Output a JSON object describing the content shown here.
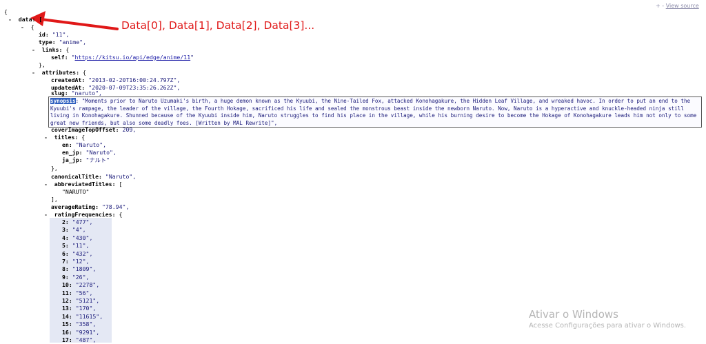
{
  "view_source": {
    "prefix": "+ - ",
    "link": "View source"
  },
  "annotation": {
    "text": "Data[0], Data[1], Data[2], Data[3]..."
  },
  "watermark": {
    "title": "Ativar o Windows",
    "subtitle": "Acesse Configurações para ativar o Windows."
  },
  "json": {
    "open_brace": "{",
    "data_line": "data: [",
    "item_open": "{",
    "id_key": "id:",
    "id_val": "\"11\",",
    "type_key": "type:",
    "type_val": "\"anime\",",
    "links_key": "links:",
    "links_open": "{",
    "self_key": "self:",
    "self_q1": "\"",
    "self_url": "https://kitsu.io/api/edge/anime/11",
    "self_q2": "\"",
    "links_close": "},",
    "attributes_key": "attributes:",
    "attributes_open": "{",
    "createdAt_key": "createdAt:",
    "createdAt_val": "\"2013-02-20T16:00:24.797Z\",",
    "updatedAt_key": "updatedAt:",
    "updatedAt_val": "\"2020-07-09T23:35:26.262Z\",",
    "slug_key": "slug:",
    "slug_val": "\"naruto\",",
    "synopsis_key": "synopsis",
    "synopsis_val": ": \"Moments prior to Naruto Uzumaki's birth, a huge demon known as the Kyuubi, the Nine-Tailed Fox, attacked Konohagakure, the Hidden Leaf Village, and wreaked havoc. In order to put an end to the Kyuubi's rampage, the leader of the village, the Fourth Hokage, sacrificed his life and sealed the monstrous beast inside the newborn Naruto. Now, Naruto is a hyperactive and knuckle-headed ninja still living in Konohagakure. Shunned because of the Kyuubi inside him, Naruto struggles to find his place in the village, while his burning desire to become the Hokage of Konohagakure leads him not only to some great new friends, but also some deadly foes. [Written by MAL Rewrite]\",",
    "coverImageTopOffset_key": "coverImageTopOffset:",
    "coverImageTopOffset_val": "209,",
    "titles_key": "titles:",
    "titles_open": "{",
    "en_key": "en:",
    "en_val": "\"Naruto\",",
    "en_jp_key": "en_jp:",
    "en_jp_val": "\"Naruto\",",
    "ja_jp_key": "ja_jp:",
    "ja_jp_val": "\"ナルト\"",
    "titles_close": "},",
    "canonicalTitle_key": "canonicalTitle:",
    "canonicalTitle_val": "\"Naruto\",",
    "abbreviatedTitles_key": "abbreviatedTitles:",
    "abbreviatedTitles_open": "[",
    "abbreviatedTitles_item": "\"NARUTO\"",
    "abbreviatedTitles_close": "],",
    "averageRating_key": "averageRating:",
    "averageRating_val": "\"78.94\",",
    "ratingFrequencies_key": "ratingFrequencies:",
    "ratingFrequencies_open": "{",
    "ratingFrequencies": [
      {
        "k": "2:",
        "v": "\"477\","
      },
      {
        "k": "3:",
        "v": "\"4\","
      },
      {
        "k": "4:",
        "v": "\"430\","
      },
      {
        "k": "5:",
        "v": "\"11\","
      },
      {
        "k": "6:",
        "v": "\"432\","
      },
      {
        "k": "7:",
        "v": "\"12\","
      },
      {
        "k": "8:",
        "v": "\"1809\","
      },
      {
        "k": "9:",
        "v": "\"26\","
      },
      {
        "k": "10:",
        "v": "\"2278\","
      },
      {
        "k": "11:",
        "v": "\"56\","
      },
      {
        "k": "12:",
        "v": "\"5121\","
      },
      {
        "k": "13:",
        "v": "\"170\","
      },
      {
        "k": "14:",
        "v": "\"11615\","
      },
      {
        "k": "15:",
        "v": "\"358\","
      },
      {
        "k": "16:",
        "v": "\"9291\","
      },
      {
        "k": "17:",
        "v": "\"487\","
      }
    ],
    "toggle_minus": "-"
  },
  "colors": {
    "annotation": "#e01818",
    "selection": "#2f5fbf",
    "highlight_bg": "#e4e8f4"
  }
}
